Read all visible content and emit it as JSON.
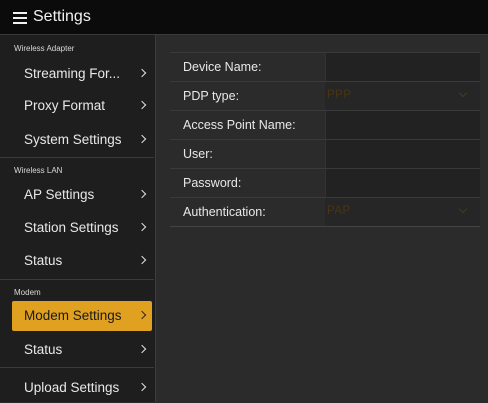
{
  "header": {
    "title": "Settings"
  },
  "sidebar": {
    "sections": [
      {
        "label": "Wireless Adapter",
        "items": [
          {
            "label": "Streaming For..."
          },
          {
            "label": "Proxy Format"
          },
          {
            "label": "System Settings"
          }
        ]
      },
      {
        "label": "Wireless LAN",
        "items": [
          {
            "label": "AP Settings"
          },
          {
            "label": "Station Settings"
          },
          {
            "label": "Status"
          }
        ]
      },
      {
        "label": "Modem",
        "items": [
          {
            "label": "Modem Settings",
            "active": true
          },
          {
            "label": "Status"
          }
        ]
      }
    ],
    "footer_item": {
      "label": "Upload Settings"
    }
  },
  "form": {
    "rows": [
      {
        "label": "Device Name:",
        "value": ""
      },
      {
        "label": "PDP type:",
        "value": "PPP",
        "type": "select"
      },
      {
        "label": "Access Point Name:",
        "value": ""
      },
      {
        "label": "User:",
        "value": ""
      },
      {
        "label": "Password:",
        "value": ""
      },
      {
        "label": "Authentication:",
        "value": "PAP",
        "type": "select"
      }
    ]
  },
  "colors": {
    "accent": "#e0a020",
    "header_bg": "#0b0b0b",
    "sidebar_bg": "#1e1e1e",
    "content_bg": "#2b2b2b"
  }
}
